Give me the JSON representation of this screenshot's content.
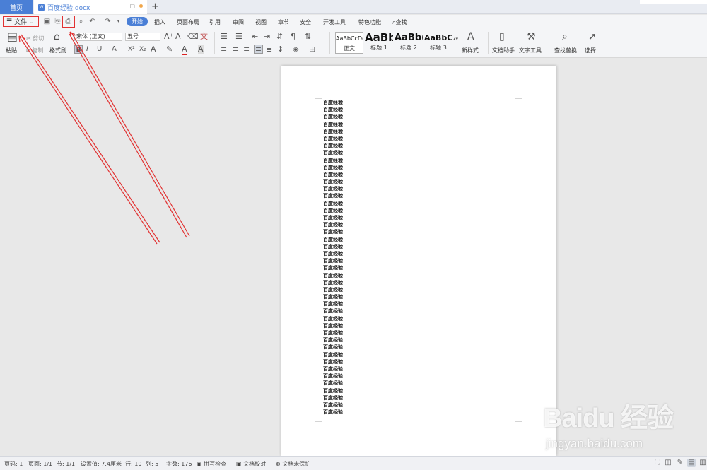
{
  "tabs": {
    "home": "首页",
    "document_title": "百度经验.docx",
    "new_tab": "+"
  },
  "menu": {
    "file": "文件",
    "items": [
      "开始",
      "插入",
      "页面布局",
      "引用",
      "审阅",
      "视图",
      "章节",
      "安全",
      "开发工具",
      "特色功能"
    ],
    "search": "查找"
  },
  "ribbon": {
    "paste": "粘贴",
    "cut": "剪切",
    "copy": "复制",
    "format_painter": "格式刷",
    "font_name": "宋体 (正文)",
    "font_size": "五号",
    "styles": [
      {
        "sample": "AaBbCcDd",
        "label": "正文"
      },
      {
        "sample": "AaBb",
        "label": "标题 1"
      },
      {
        "sample": "AaBb(",
        "label": "标题 2"
      },
      {
        "sample": "AaBbC(",
        "label": "标题 3"
      }
    ],
    "new_style": "新样式",
    "doc_assistant": "文档助手",
    "text_tools": "文字工具",
    "find_replace": "查找替换",
    "select": "选择"
  },
  "document": {
    "line_text": "百度经验",
    "line_count": 44
  },
  "status": {
    "page_num": "页码: 1",
    "pages": "页面: 1/1",
    "section": "节: 1/1",
    "set_value": "设置值: 7.4厘米",
    "row": "行: 10",
    "col": "列: 5",
    "word_count": "字数: 176",
    "spell_check": "拼写检查",
    "doc_proof": "文档校对",
    "doc_protect": "文档未保护"
  },
  "watermark": {
    "brand": "Baidu 经验",
    "url": "jingyan.baidu.com"
  },
  "colors": {
    "accent": "#4a7fd6",
    "highlight": "#e23232"
  }
}
